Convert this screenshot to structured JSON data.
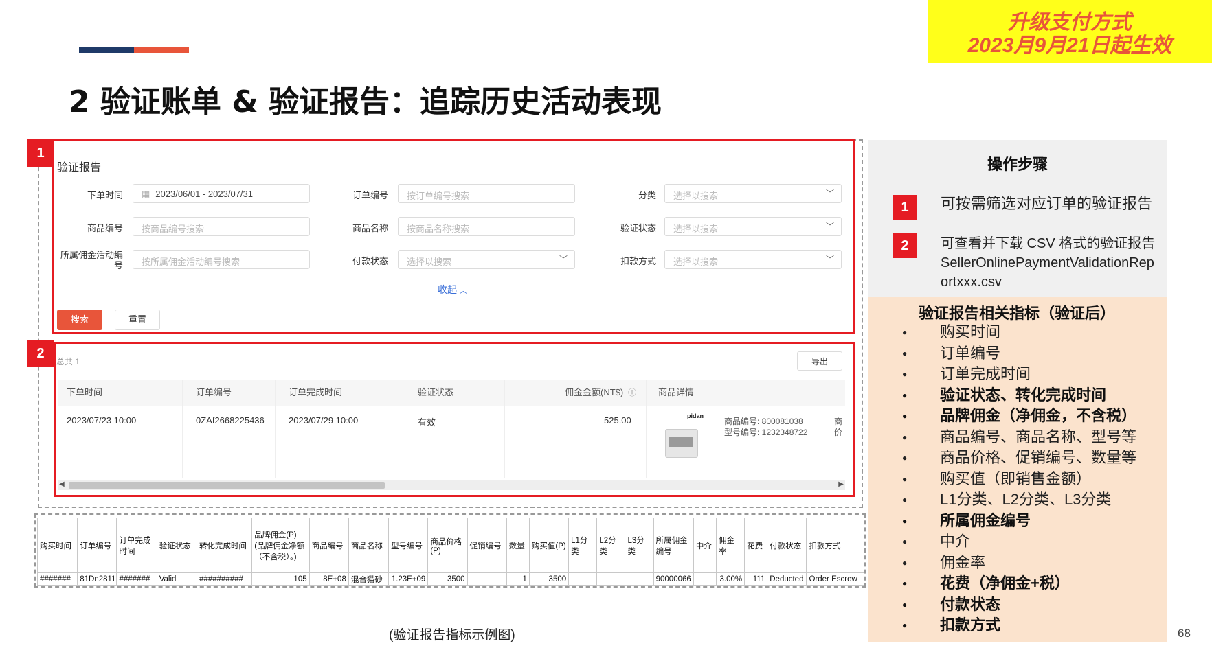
{
  "banner": {
    "line1": "升级支付方式",
    "line2": "2023月9月21日起生效"
  },
  "page_title": "2 验证账单 & 验证报告：追踪历史活动表现",
  "badges": {
    "b1": "1",
    "b2": "2"
  },
  "filter": {
    "heading": "验证报告",
    "order_time_label": "下单时间",
    "order_time_value": "2023/06/01  -  2023/07/31",
    "order_no_label": "订单编号",
    "order_no_ph": "按订单编号搜索",
    "category_label": "分类",
    "category_ph": "选择以搜索",
    "product_no_label": "商品编号",
    "product_no_ph": "按商品编号搜索",
    "product_name_label": "商品名称",
    "product_name_ph": "按商品名称搜索",
    "verify_status_label": "验证状态",
    "verify_status_ph": "选择以搜索",
    "campaign_label": "所属佣金活动编号",
    "campaign_ph": "按所属佣金活动编号搜索",
    "pay_status_label": "付款状态",
    "pay_status_ph": "选择以搜索",
    "deduct_label": "扣款方式",
    "deduct_ph": "选择以搜索",
    "collapse": "收起",
    "search_btn": "搜索",
    "reset_btn": "重置"
  },
  "results": {
    "total": "总共 1",
    "export_btn": "导出",
    "headers": [
      "下单时间",
      "订单编号",
      "订单完成时间",
      "验证状态",
      "佣金金额(NT$)",
      "商品详情"
    ],
    "row": {
      "order_time": "2023/07/23 10:00",
      "order_no": "0ZAf2668225436",
      "complete_time": "2023/07/29 10:00",
      "status": "有效",
      "commission": "525.00",
      "brand": "pidan",
      "product_no": "商品编号: 800081038",
      "model_no": "型号编号: 1232348722",
      "extra1": "商",
      "extra2": "价"
    }
  },
  "csv": {
    "headers": [
      "购买时间",
      "订单编号",
      "订单完成时间",
      "验证状态",
      "转化完成时间",
      "品牌佣金(P)(品牌佣金净额（不含税）。)",
      "商品编号",
      "商品名称",
      "型号编号",
      "商品价格(P)",
      "促销编号",
      "数量",
      "购买值(P)",
      "L1分类",
      "L2分类",
      "L3分类",
      "所属佣金编号",
      "中介",
      "佣金率",
      "花费",
      "付款状态",
      "扣款方式"
    ],
    "row": [
      "#######",
      "81Dn2811",
      "#######",
      "Valid",
      "##########",
      "105",
      "8E+08",
      "混合猫砂",
      "1.23E+09",
      "3500",
      "",
      "1",
      "3500",
      "",
      "",
      "",
      "90000066",
      "",
      "3.00%",
      "111",
      "Deducted",
      "Order Escrow"
    ]
  },
  "caption": "(验证报告指标示例图)",
  "steps": {
    "title": "操作步骤",
    "s1": "可按需筛选对应订单的验证报告",
    "s2_l1": "可查看并下载 CSV 格式的验证报告",
    "s2_l2": "SellerOnlinePaymentValidationRep",
    "s2_l3": "ortxxx.csv"
  },
  "indicators": {
    "title": "验证报告相关指标（验证后）",
    "items": [
      "购买时间",
      "订单编号",
      "订单完成时间",
      "验证状态、转化完成时间",
      "品牌佣金（净佣金，不含税）",
      "商品编号、商品名称、型号等",
      "商品价格、促销编号、数量等",
      "购买值（即销售金额）",
      "L1分类、L2分类、L3分类",
      "所属佣金编号",
      "中介",
      "佣金率",
      "花费（净佣金+税）",
      "付款状态",
      "扣款方式"
    ]
  },
  "page_number": "68",
  "colors": {
    "accent_red": "#e51c23",
    "accent_orange": "#e8553a",
    "navy": "#1f3a68",
    "banner_yellow": "#ffff1a",
    "peach": "#fbe3cd"
  }
}
